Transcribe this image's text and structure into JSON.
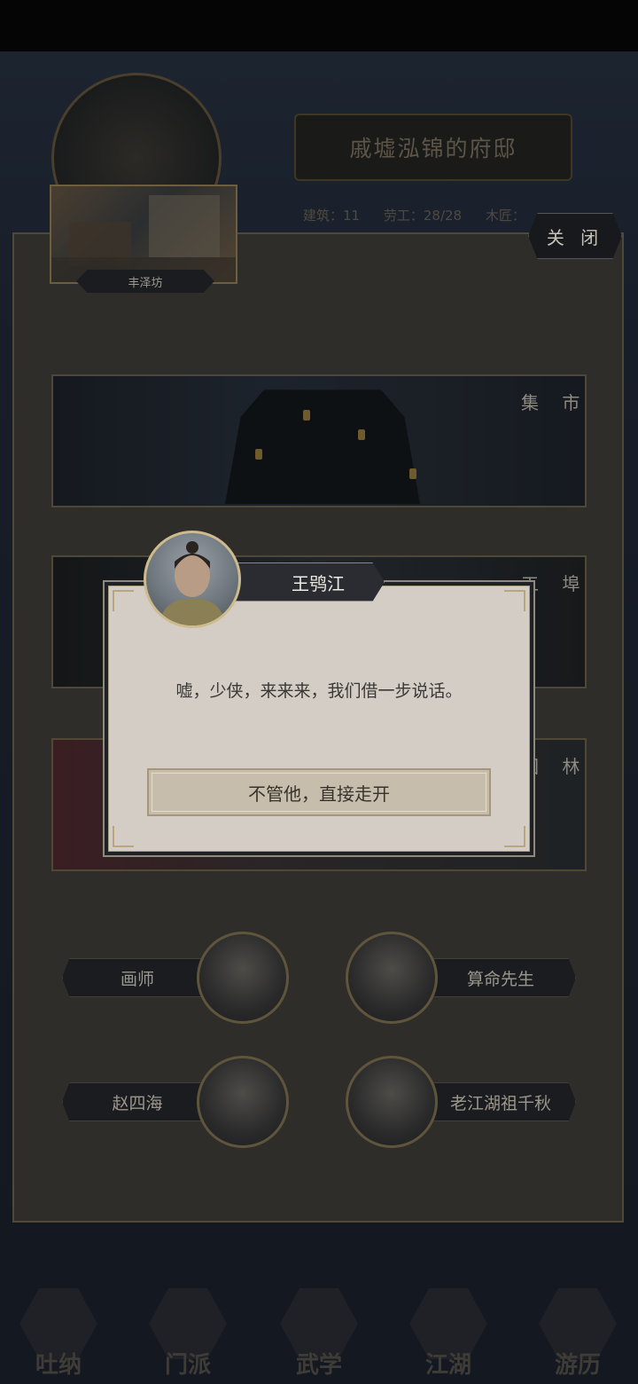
{
  "header": {
    "title": "戚墟泓锦的府邸",
    "stats": [
      "建筑：11",
      "劳工：28/28",
      "木匠："
    ]
  },
  "panel": {
    "close_label": "关 闭",
    "district_name": "丰泽坊",
    "locations": [
      {
        "label": "集 市"
      },
      {
        "label": "工 埠"
      },
      {
        "label": "园 林"
      }
    ],
    "npcs": [
      {
        "name": "画师",
        "portrait_icon": "painter-portrait"
      },
      {
        "name": "算命先生",
        "portrait_icon": "fortune-teller-portrait"
      },
      {
        "name": "赵四海",
        "portrait_icon": "zhao-sihai-portrait"
      },
      {
        "name": "老江湖祖千秋",
        "portrait_icon": "zu-qianqiu-portrait"
      }
    ]
  },
  "dialog": {
    "speaker": "王鸮江",
    "text": "嘘，少侠，来来来，我们借一步说话。",
    "option_label": "不管他，直接走开"
  },
  "bottom_nav": {
    "items": [
      {
        "label": "吐纳"
      },
      {
        "label": "门派"
      },
      {
        "label": "武学"
      },
      {
        "label": "江湖"
      },
      {
        "label": "游历"
      }
    ]
  },
  "colors": {
    "dialog_bg": "#d3cdc5",
    "banner_bg": "#2a2c31",
    "gold_trim": "#cdbb8d"
  }
}
